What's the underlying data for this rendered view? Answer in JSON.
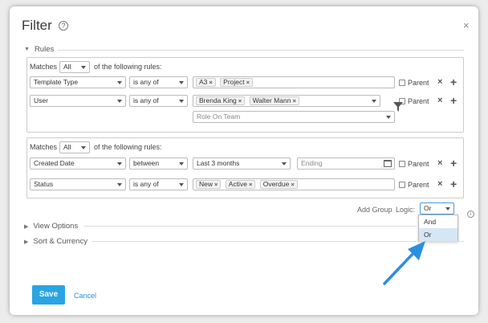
{
  "dialog": {
    "title": "Filter",
    "help_icon": "?",
    "close_icon": "×"
  },
  "rules_section": {
    "label": "Rules",
    "group1": {
      "matches_label": "Matches",
      "matches_value": "All",
      "following_label": "of the following rules:",
      "rows": [
        {
          "field": "Template Type",
          "operator": "is any of",
          "tags": [
            "A3",
            "Project"
          ],
          "parent_label": "Parent"
        },
        {
          "field": "User",
          "operator": "is any of",
          "tags": [
            "Brenda King",
            "Walter Mann"
          ],
          "parent_label": "Parent",
          "sub_select": "Role On Team"
        }
      ]
    },
    "group2": {
      "matches_label": "Matches",
      "matches_value": "All",
      "following_label": "of the following rules:",
      "rows": [
        {
          "field": "Created Date",
          "operator": "between",
          "value": "Last 3 months",
          "ending": "Ending",
          "parent_label": "Parent"
        },
        {
          "field": "Status",
          "operator": "is any of",
          "tags": [
            "New",
            "Active",
            "Overdue"
          ],
          "parent_label": "Parent"
        }
      ]
    },
    "add_group_label": "Add Group",
    "logic_label": "Logic:",
    "logic_value": "Or",
    "logic_options": [
      "And",
      "Or"
    ]
  },
  "view_options_label": "View Options",
  "sort_currency_label": "Sort & Currency",
  "save_label": "Save",
  "cancel_label": "Cancel",
  "icons": {
    "remove": "×",
    "add": "+",
    "info": "i"
  },
  "colors": {
    "primary": "#2aa4e4",
    "arrow": "#2b8fe0",
    "link": "#2a8ed8"
  }
}
